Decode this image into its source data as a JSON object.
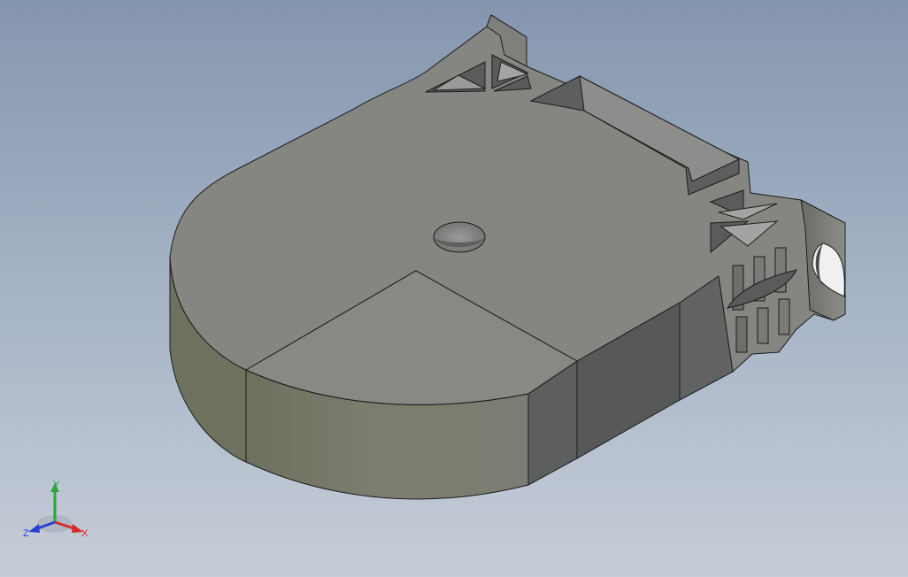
{
  "viewport": {
    "background_top": "#8496ae",
    "background_bottom": "#c6cdd7"
  },
  "model": {
    "body_color": "#858681",
    "side_color": "#7b7c6f",
    "dark_face_color": "#5e5f5f",
    "edge_color": "#1c1c1c",
    "features": [
      "center-hole",
      "triangular-ribs",
      "rectangular-pocket",
      "side-slots",
      "mounting-lug"
    ]
  },
  "triad": {
    "x_label": "X",
    "y_label": "Y",
    "z_label": "Z",
    "x_color": "#d42a2a",
    "y_color": "#2aa53a",
    "z_color": "#2a3fd4"
  }
}
